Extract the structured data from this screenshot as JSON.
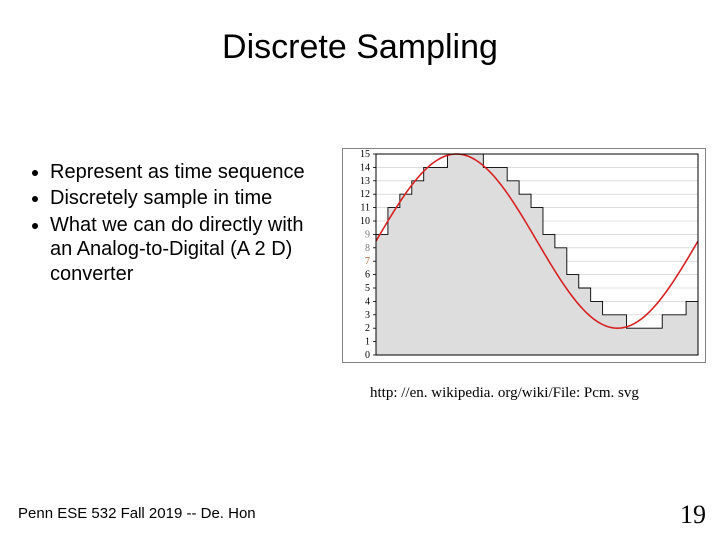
{
  "title": "Discrete Sampling",
  "bullets": [
    "Represent as time sequence",
    "Discretely sample in time",
    "What we can do directly with an Analog-to-Digital (A 2 D) converter"
  ],
  "caption": "http: //en. wikipedia. org/wiki/File: Pcm. svg",
  "footer": "Penn ESE 532 Fall 2019 -- De. Hon",
  "page_number": "19",
  "chart_data": {
    "type": "line",
    "title": "",
    "xlabel": "",
    "ylabel": "",
    "ylim": [
      0,
      15
    ],
    "xlim": [
      0,
      26
    ],
    "yticks": [
      0,
      1,
      2,
      3,
      4,
      5,
      6,
      7,
      8,
      9,
      10,
      11,
      12,
      13,
      14,
      15
    ],
    "bars": [
      9,
      11,
      12,
      13,
      14,
      14,
      15,
      15,
      15,
      14,
      14,
      13,
      12,
      11,
      9,
      8,
      6,
      5,
      4,
      3,
      3,
      2,
      2,
      2,
      3,
      3,
      4
    ],
    "sine": {
      "amplitude": 6.5,
      "mid": 8.5,
      "period": 26
    }
  }
}
